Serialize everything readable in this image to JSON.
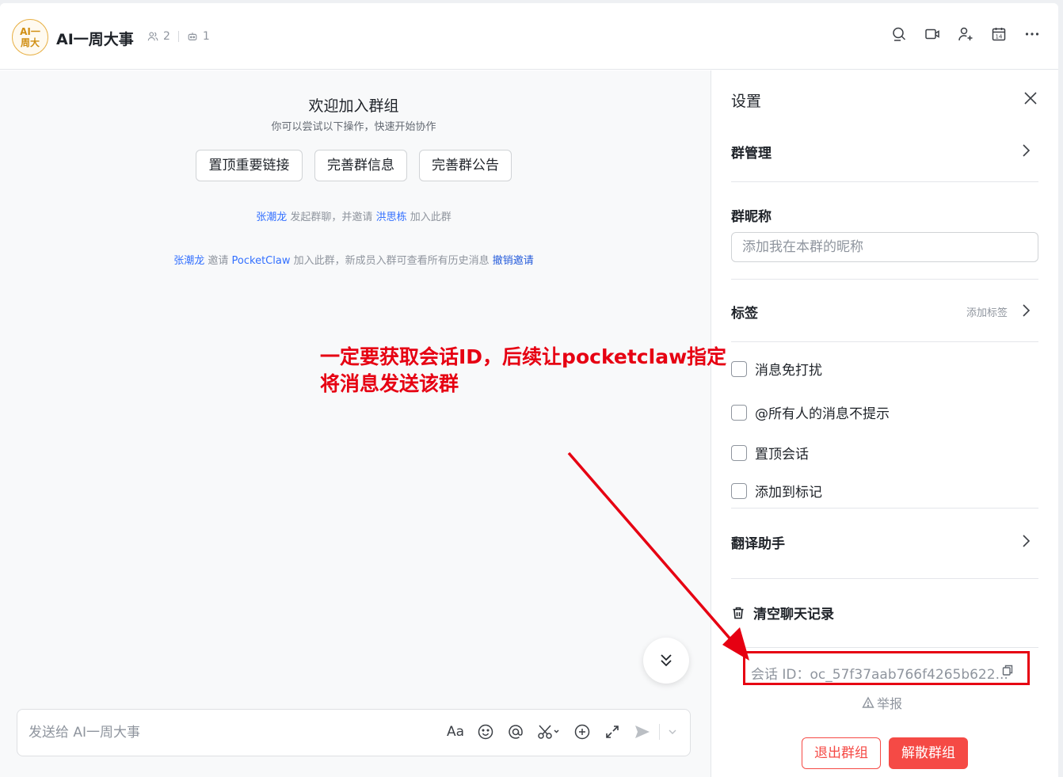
{
  "header": {
    "avatar_line1": "AI一",
    "avatar_line2": "周大",
    "title": "AI一周大事",
    "member_count": "2",
    "bot_count": "1",
    "tools": [
      "search-icon",
      "video-icon",
      "add-member-icon",
      "calendar-icon",
      "more-icon"
    ],
    "calendar_day": "14"
  },
  "chat": {
    "welcome_title": "欢迎加入群组",
    "welcome_sub": "你可以尝试以下操作，快速开始协作",
    "actions": [
      "置顶重要链接",
      "完善群信息",
      "完善群公告"
    ],
    "sys1": {
      "user": "张潮龙",
      "text1": "发起群聊，并邀请",
      "invitee": "洪思栋",
      "text2": "加入此群"
    },
    "sys2": {
      "user": "张潮龙",
      "text1": "邀请",
      "invitee": "PocketClaw",
      "text2": "加入此群，新成员入群可查看所有历史消息",
      "revoke": "撤销邀请"
    },
    "annotation_line1": "一定要获取会话ID，后续让pocketclaw指定",
    "annotation_line2": "将消息发送该群",
    "composer_placeholder": "发送给 AI一周大事",
    "composer_font_label": "Aa"
  },
  "settings": {
    "title": "设置",
    "group_manage": "群管理",
    "nickname_label": "群昵称",
    "nickname_placeholder": "添加我在本群的昵称",
    "tags_label": "标签",
    "tags_hint": "添加标签",
    "checks": [
      "消息免打扰",
      "@所有人的消息不提示",
      "置顶会话",
      "添加到标记"
    ],
    "translate": "翻译助手",
    "clear_history": "清空聊天记录",
    "session_id": "会话 ID：oc_57f37aab766f4265b622...",
    "report": "举报",
    "exit": "退出群组",
    "dissolve": "解散群组"
  },
  "colors": {
    "accent_blue": "#3370ff",
    "danger_red": "#f54a45",
    "annotation_red": "#e60012"
  }
}
